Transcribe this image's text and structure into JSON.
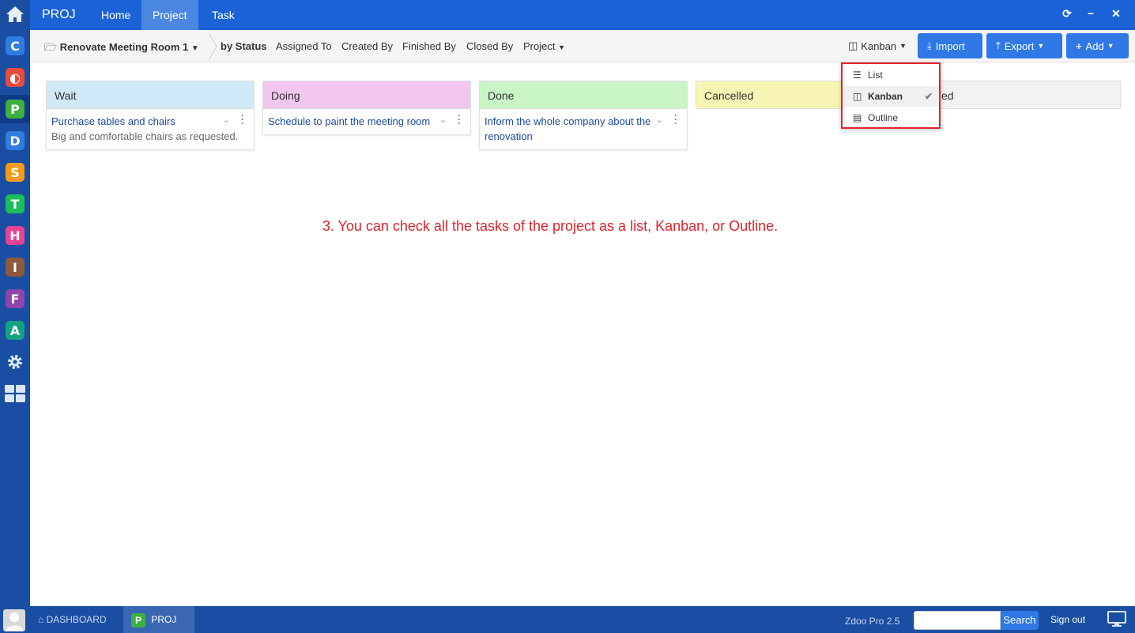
{
  "topbar": {
    "app_name": "PROJ",
    "nav": [
      "Home",
      "Project",
      "Task"
    ],
    "window_controls": [
      "refresh-icon",
      "minimize-icon",
      "close-icon"
    ]
  },
  "launcher": {
    "apps": [
      {
        "letter": "C",
        "color": "#2f7de1"
      },
      {
        "letter": "◐",
        "color": "#e74c3c"
      },
      {
        "letter": "P",
        "color": "#3cb043"
      },
      {
        "letter": "D",
        "color": "#2f7de1"
      },
      {
        "letter": "S",
        "color": "#f39c12"
      },
      {
        "letter": "T",
        "color": "#1bbf5a"
      },
      {
        "letter": "H",
        "color": "#e84393"
      },
      {
        "letter": "I",
        "color": "#8e5a3c"
      },
      {
        "letter": "F",
        "color": "#8e44ad"
      },
      {
        "letter": "A",
        "color": "#16a085"
      }
    ]
  },
  "subbar": {
    "breadcrumb": "Renovate Meeting Room 1",
    "tabs": [
      "by Status",
      "Assigned To",
      "Created By",
      "Finished By",
      "Closed By",
      "Project"
    ],
    "view_switch": "Kanban",
    "import_label": "Import",
    "export_label": "Export",
    "add_label": "Add"
  },
  "lanes": [
    {
      "title": "Wait",
      "color": "#cfe9f7",
      "cards": [
        {
          "title": "Purchase tables and chairs",
          "desc": "Big and comfortable chairs as requested."
        }
      ]
    },
    {
      "title": "Doing",
      "color": "#f2c6ef",
      "cards": [
        {
          "title": "Schedule to paint the meeting room",
          "desc": ""
        }
      ]
    },
    {
      "title": "Done",
      "color": "#c9f5c6",
      "cards": [
        {
          "title": "Inform the whole company about the renovation",
          "desc": ""
        }
      ]
    },
    {
      "title": "Cancelled",
      "color": "#f7f5b4",
      "cards": []
    },
    {
      "title": "ed",
      "color": "#f2f2f2",
      "cards": []
    }
  ],
  "view_menu": {
    "items": [
      "List",
      "Kanban",
      "Outline"
    ],
    "selected": "Kanban"
  },
  "instruction": "3. You can check all the tasks of the project as a list, Kanban, or Outline.",
  "bottombar": {
    "dashboard_label": "DASHBOARD",
    "proj_label": "PROJ",
    "version": "Zdoo Pro 2.5",
    "search_label": "Search",
    "signout_label": "Sign out"
  }
}
